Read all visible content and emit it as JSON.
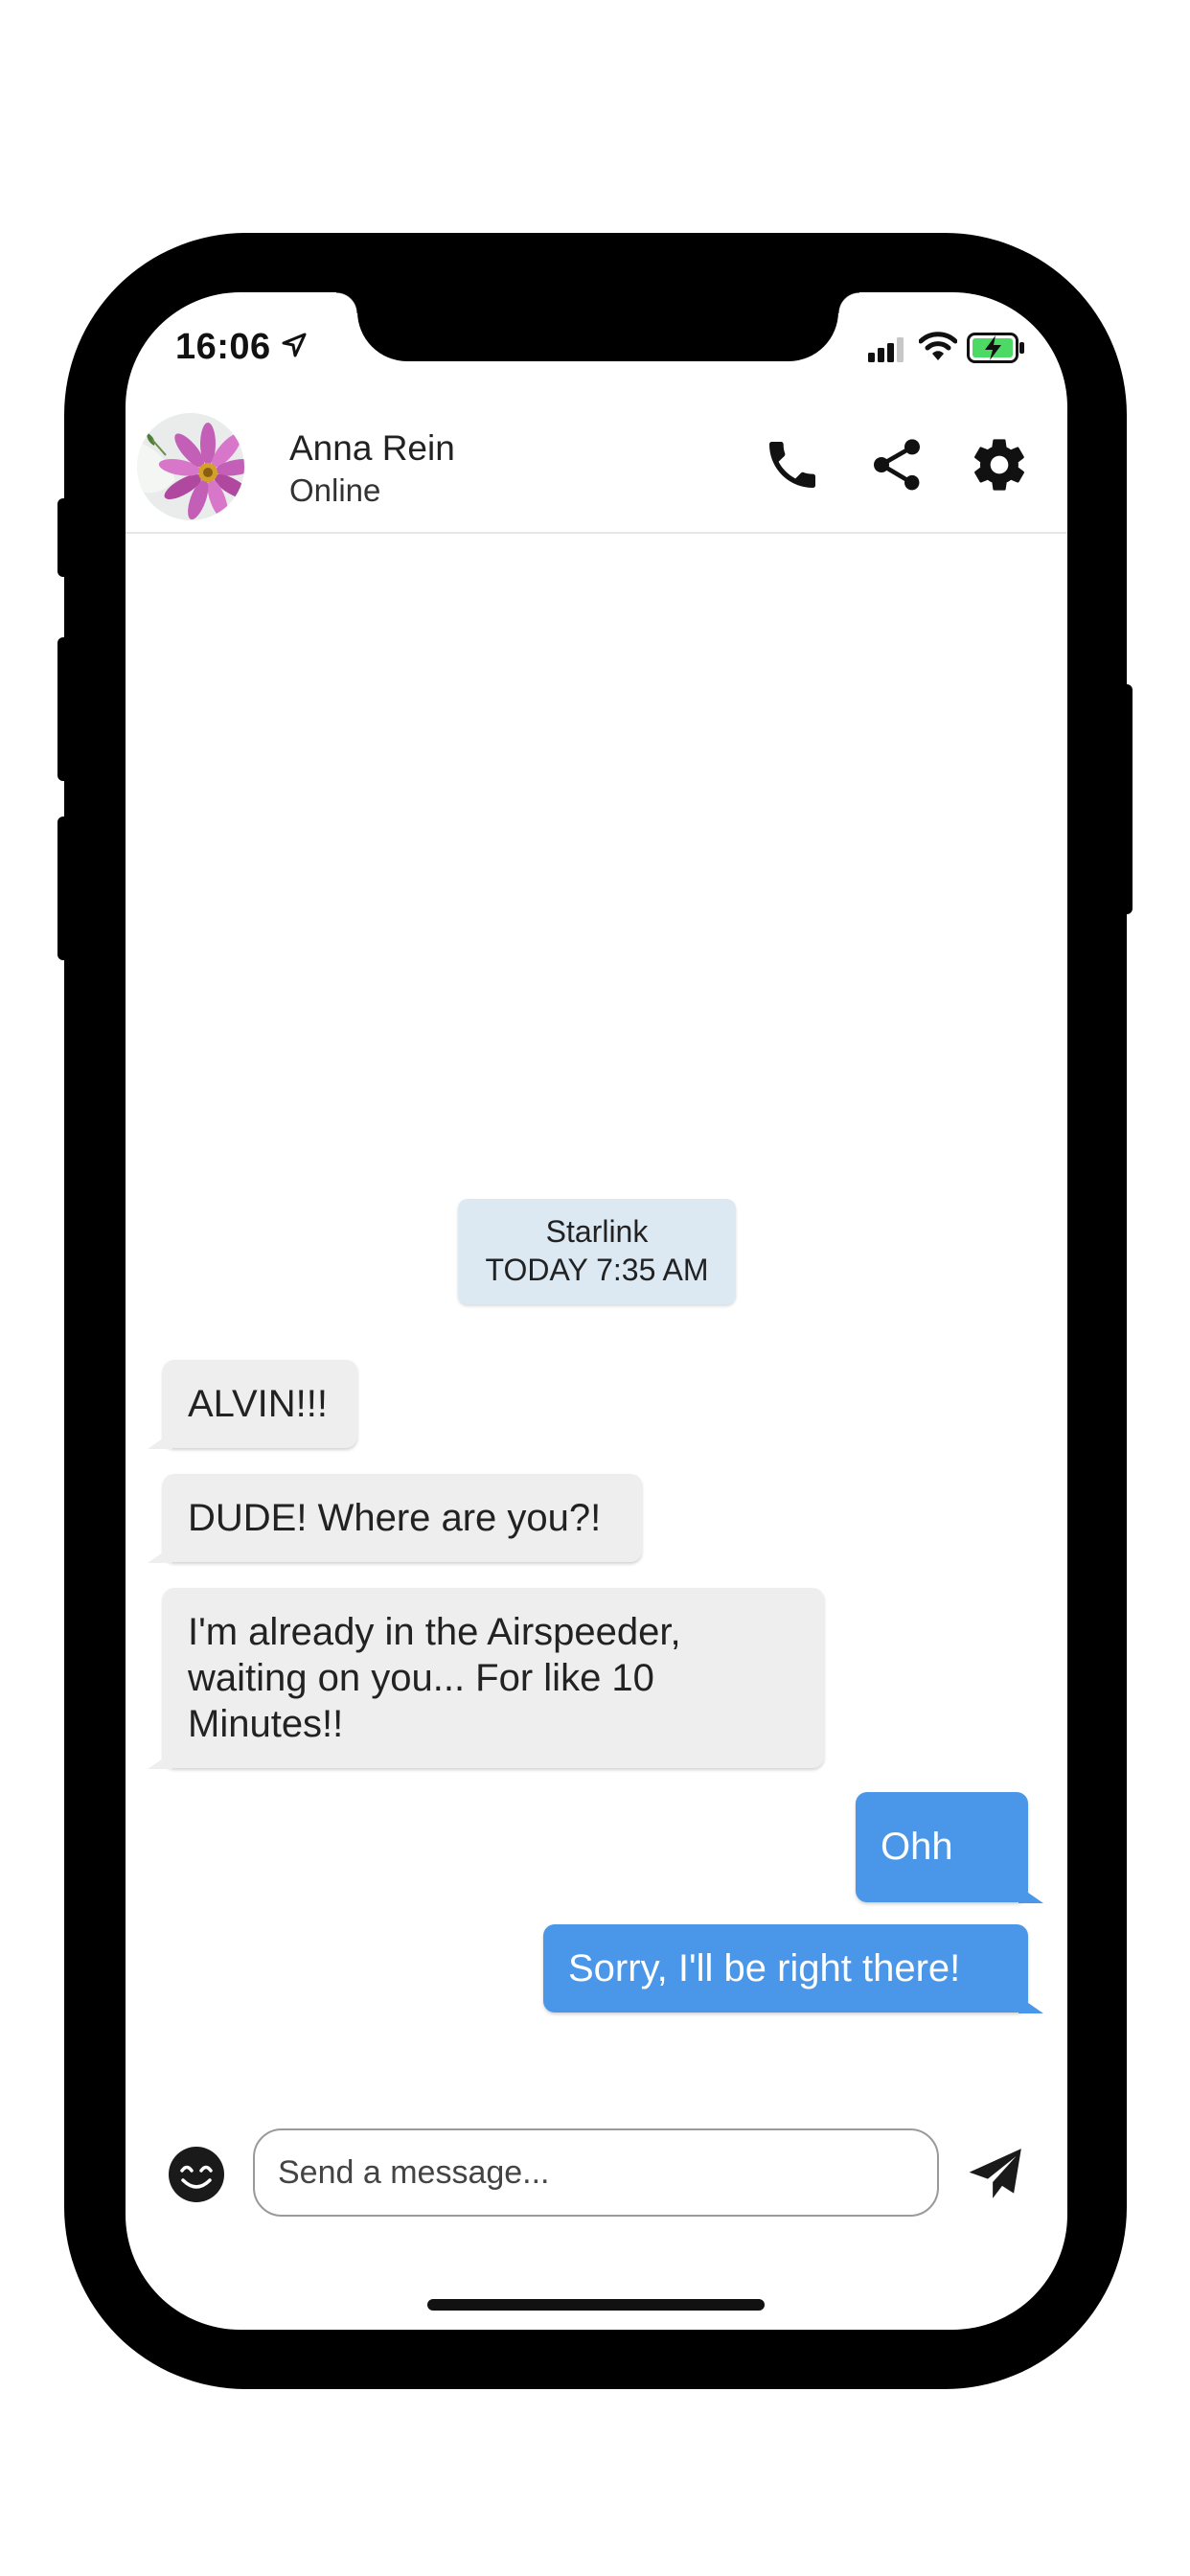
{
  "status_bar": {
    "time": "16:06",
    "icons": [
      "location-arrow-icon",
      "cellular-signal-icon",
      "wifi-icon",
      "battery-charging-icon"
    ]
  },
  "header": {
    "contact_name": "Anna Rein",
    "contact_status": "Online",
    "avatar": "flower-avatar",
    "actions": [
      "phone-icon",
      "share-icon",
      "gear-icon"
    ]
  },
  "conversation": {
    "date_chip": {
      "line1": "Starlink",
      "line2": "TODAY 7:35 AM"
    },
    "messages": [
      {
        "direction": "incoming",
        "text": "ALVIN!!!"
      },
      {
        "direction": "incoming",
        "text": "DUDE! Where are you?!"
      },
      {
        "direction": "incoming",
        "text_lines": [
          "I'm already in the Airspeeder,",
          "waiting on you... For like 10",
          "Minutes!!"
        ]
      },
      {
        "direction": "outgoing",
        "text": "Ohh 😂"
      },
      {
        "direction": "outgoing",
        "text": "Sorry, I'll be right there!"
      }
    ]
  },
  "composer": {
    "placeholder": "Send a message...",
    "value": "",
    "emoji_icon": "smiley-icon",
    "send_icon": "send-icon"
  },
  "colors": {
    "outgoing_bubble": "#4a96e8",
    "incoming_bubble": "#eeeeee",
    "date_chip": "#dce9f3",
    "battery_charging": "#4cd964"
  }
}
